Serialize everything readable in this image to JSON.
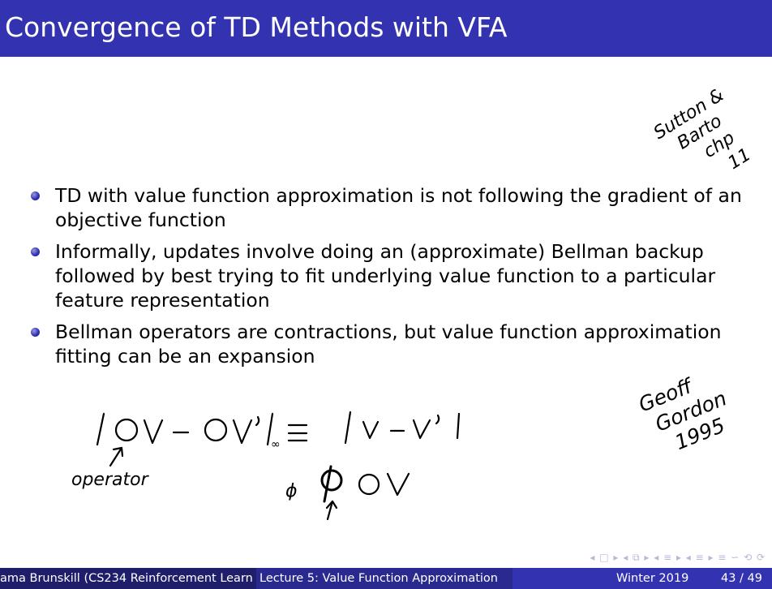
{
  "slide": {
    "title": "Convergence of TD Methods with VFA",
    "bullets": [
      "TD with value function approximation is not following the gradient of an objective function",
      "Informally, updates involve doing an (approximate) Bellman backup followed by best trying to fit underlying value function to a particular feature representation",
      "Bellman operators are contractions, but value function approximation fitting can be an expansion"
    ]
  },
  "annotations": {
    "reference_1": "Sutton & Barto chp 11",
    "reference_2": "Geoff Gordon 1995",
    "equation": "|OV - OV'|∞ ≤ |V - V'|",
    "operator_label": "operator",
    "phi_expression": "Φ OV"
  },
  "footer": {
    "author": "ama Brunskill (CS234 Reinforcement Learn",
    "lecture": "Lecture 5: Value Function Approximation",
    "date": "Winter 2019",
    "page": "43 / 49"
  },
  "nav": {
    "symbols": "◂ □ ▸ ◂ ⧉ ▸ ◂ ≡ ▸ ◂ ≡ ▸  ≡  ∽ ⟲ ⟳"
  },
  "colors": {
    "title_bar": "#3333b2",
    "footer_left": "#1e1e6b",
    "footer_mid": "#29298f",
    "footer_right": "#3333b2"
  }
}
